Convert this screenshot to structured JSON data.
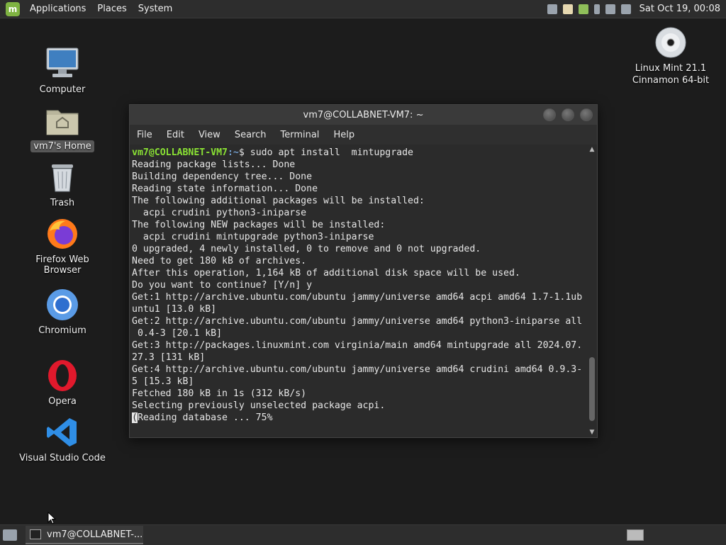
{
  "top_panel": {
    "menus": [
      "Applications",
      "Places",
      "System"
    ],
    "clock": "Sat Oct 19, 00:08",
    "tray_icons": [
      "network-icon",
      "notes-icon",
      "shield-icon",
      "mic-icon",
      "volume-icon",
      "network-wired-icon"
    ]
  },
  "desktop": {
    "icons": [
      {
        "name": "computer",
        "label": "Computer"
      },
      {
        "name": "home",
        "label": "vm7's Home"
      },
      {
        "name": "trash",
        "label": "Trash"
      },
      {
        "name": "firefox",
        "label": "Firefox Web Browser"
      },
      {
        "name": "chromium",
        "label": "Chromium"
      },
      {
        "name": "opera",
        "label": "Opera"
      },
      {
        "name": "vscode",
        "label": "Visual Studio Code"
      }
    ],
    "disc": {
      "line1": "Linux Mint 21.1",
      "line2": "Cinnamon 64-bit"
    }
  },
  "terminal": {
    "title": "vm7@COLLABNET-VM7: ~",
    "menu": [
      "File",
      "Edit",
      "View",
      "Search",
      "Terminal",
      "Help"
    ],
    "prompt_user": "vm7@COLLABNET-VM7",
    "prompt_path": ":~",
    "command": "$ sudo apt install  mintupgrade",
    "lines": [
      "Reading package lists... Done",
      "Building dependency tree... Done",
      "Reading state information... Done",
      "The following additional packages will be installed:",
      "  acpi crudini python3-iniparse",
      "The following NEW packages will be installed:",
      "  acpi crudini mintupgrade python3-iniparse",
      "0 upgraded, 4 newly installed, 0 to remove and 0 not upgraded.",
      "Need to get 180 kB of archives.",
      "After this operation, 1,164 kB of additional disk space will be used.",
      "Do you want to continue? [Y/n] y",
      "Get:1 http://archive.ubuntu.com/ubuntu jammy/universe amd64 acpi amd64 1.7-1.1ub",
      "untu1 [13.0 kB]",
      "Get:2 http://archive.ubuntu.com/ubuntu jammy/universe amd64 python3-iniparse all",
      " 0.4-3 [20.1 kB]",
      "Get:3 http://packages.linuxmint.com virginia/main amd64 mintupgrade all 2024.07.",
      "27.3 [131 kB]",
      "Get:4 http://archive.ubuntu.com/ubuntu jammy/universe amd64 crudini amd64 0.9.3-",
      "5 [15.3 kB]",
      "Fetched 180 kB in 1s (312 kB/s)",
      "Selecting previously unselected package acpi."
    ],
    "last_line_cursor": "(",
    "last_line_rest": "Reading database ... 75%"
  },
  "taskbar": {
    "window_task": "vm7@COLLABNET-..."
  },
  "colors": {
    "prompt_user": "#8ae234",
    "prompt_path": "#729fcf",
    "mint_green": "#7fb342"
  }
}
